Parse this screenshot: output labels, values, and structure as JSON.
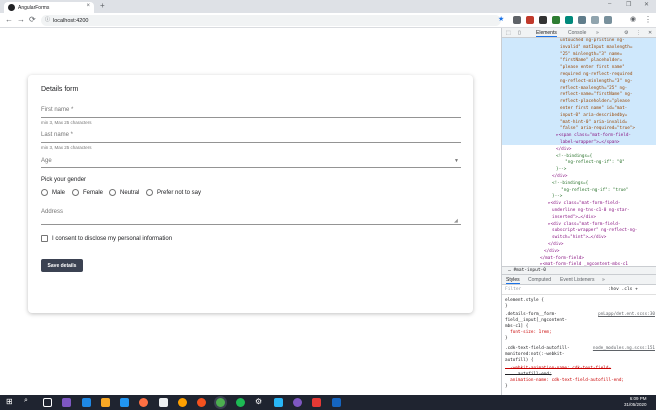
{
  "browser": {
    "tab_title": "AngularForms",
    "tab_close": "×",
    "new_tab": "+",
    "url": "localhost:4200",
    "window_controls": [
      "–",
      "❐",
      "✕"
    ]
  },
  "form": {
    "title": "Details form",
    "first_name_label": "First name *",
    "first_name_hint": "min 3, Max 25 characters",
    "last_name_label": "Last name *",
    "last_name_hint": "min 3, Max 25 characters",
    "age_label": "Age",
    "gender_label": "Pick your gender",
    "genders": [
      "Male",
      "Female",
      "Neutral",
      "Prefer not to say"
    ],
    "address_label": "Address",
    "consent_label": "I consent to disclose my personal information",
    "save_label": "Save details"
  },
  "devtools": {
    "tabs": [
      "Elements",
      "Console"
    ],
    "more": "»",
    "dom_lines": [
      "untouched ng-pristine ng-",
      "invalid\" matInput maxlength=",
      "\"25\" minlength=\"3\" name=",
      "\"firstName\" placeholder=",
      "\"please enter first name\"",
      "required ng-reflect-required",
      "ng-reflect-minlength=\"3\" ng-",
      "reflect-maxlength=\"25\" ng-",
      "reflect-name=\"firstName\" ng-",
      "reflect-placeholder=\"please",
      "enter first name\" id=\"mat-",
      "input-0\" aria-describedby=",
      "\"mat-hint-0\" aria-invalid=",
      "\"false\" aria-required=\"true\">",
      "▸<span class=\"mat-form-field-",
      "label-wrapper\">…</span>",
      "</div>",
      "<!--bindings={",
      "  \"ng-reflect-ng-if\": \"0\"",
      "}-->",
      "</div>",
      "<!--bindings={",
      "  \"ng-reflect-ng-if\": \"true\"",
      "}-->",
      "▸<div class=\"mat-form-field-",
      "underline ng-tns-c1-0 ng-star-",
      "inserted\">…</div>",
      "▸<div class=\"mat-form-field-",
      "subscript-wrapper\" ng-reflect-ng-",
      "switch=\"hint\">…</div>",
      "</div>",
      "</div>",
      "</mat-form-field>",
      "▸<mat-form-field _ngcontent-mbs-c1"
    ],
    "crumb": "#mat-input-0",
    "sub_tabs": [
      "Styles",
      "Computed",
      "Event Listeners",
      "»"
    ],
    "filter": "Filter",
    "filter_right": ":hov  .cls  +",
    "style_lines": [
      "element.style {",
      "}",
      ".details-form__form-",
      "field__input[_ngcontent-",
      "mbs-c1] {",
      "  font-size: 1rem;",
      "}",
      ".cdk-text-field-autofill-",
      "monitored:not(:-webkit-",
      "autofill) {",
      "  -webkit-animation-name: cdk-text-field-",
      "     autofill-end;",
      "  animation-name: cdk-text-field-autofill-end;",
      "}"
    ],
    "style_sources": [
      "pnLapp/det.ent.scss:30",
      "node_modules.ng.scss:151"
    ]
  },
  "taskbar": {
    "time": "6:09 PM",
    "date": "31/05/2020"
  },
  "colors": {
    "button_bg": "#3b4252",
    "devtools_highlight": "#cfe8fc",
    "taskbar_bg": "#1f2430"
  }
}
